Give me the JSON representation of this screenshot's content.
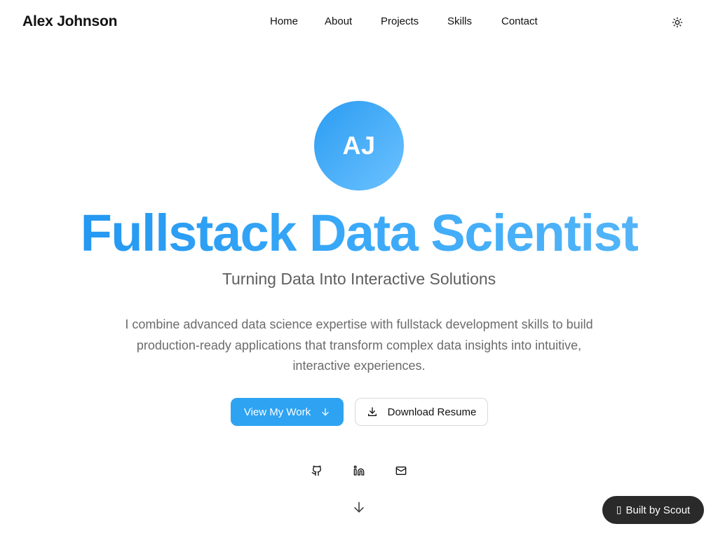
{
  "header": {
    "brand": "Alex Johnson",
    "nav": [
      "Home",
      "About",
      "Projects",
      "Skills",
      "Contact"
    ],
    "theme_toggle_icon": "sun-icon"
  },
  "hero": {
    "avatar_initials": "AJ",
    "title": "Fullstack Data Scientist",
    "subtitle": "Turning Data Into Interactive Solutions",
    "description": "I combine advanced data science expertise with fullstack development skills to build production-ready applications that transform complex data insights into intuitive, interactive experiences.",
    "primary_button": "View My Work",
    "secondary_button": "Download Resume"
  },
  "social": {
    "icons": [
      "github-icon",
      "linkedin-icon",
      "mail-icon"
    ]
  },
  "badge": {
    "glyph": "▯",
    "label": "Built by Scout"
  },
  "colors": {
    "accent": "#2ea3f2",
    "badge_bg": "#2a2a2a",
    "text": "#111111",
    "muted": "#6b6b6b"
  }
}
